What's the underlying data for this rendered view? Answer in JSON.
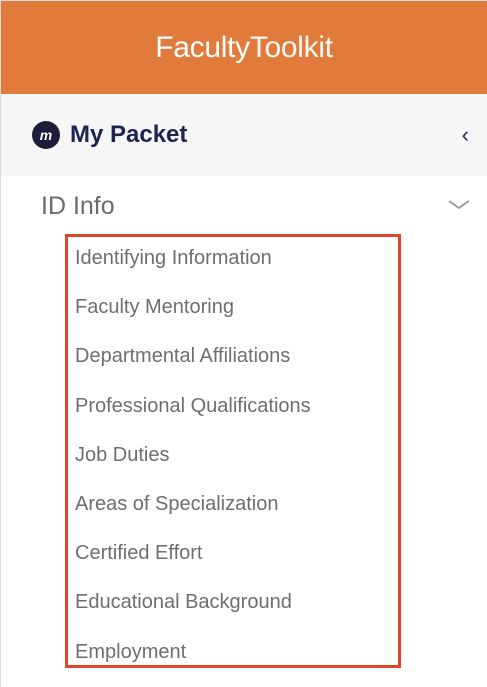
{
  "header": {
    "brand_part1": "Faculty",
    "brand_part2": "Toolkit",
    "bg_color": "#e07b3c"
  },
  "packet": {
    "logo_letter": "m",
    "title": "My Packet",
    "collapse_glyph": "‹",
    "logo_icon": "faculty-logo-icon",
    "collapse_icon": "chevron-left-icon"
  },
  "section": {
    "label": "ID Info",
    "chevron_glyph": "⌄",
    "chevron_icon": "chevron-down-icon"
  },
  "submenu": {
    "highlight_color": "#e0442b",
    "items": [
      {
        "label": "Identifying Information"
      },
      {
        "label": "Faculty Mentoring"
      },
      {
        "label": "Departmental Affiliations"
      },
      {
        "label": "Professional Qualifications"
      },
      {
        "label": "Job Duties"
      },
      {
        "label": "Areas of Specialization"
      },
      {
        "label": "Certified Effort"
      },
      {
        "label": "Educational Background"
      },
      {
        "label": "Employment"
      }
    ]
  }
}
